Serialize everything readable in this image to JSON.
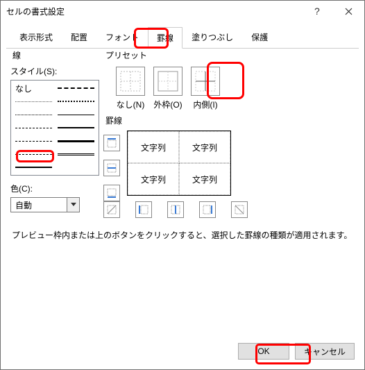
{
  "title": "セルの書式設定",
  "tabs": [
    "表示形式",
    "配置",
    "フォント",
    "罫線",
    "塗りつぶし",
    "保護"
  ],
  "active_tab": 3,
  "left": {
    "group": "線",
    "style_label": "スタイル(S):",
    "none_label": "なし",
    "color_label": "色(C):",
    "color_value": "自動"
  },
  "preset": {
    "group": "プリセット",
    "items": [
      {
        "label": "なし(N)"
      },
      {
        "label": "外枠(O)"
      },
      {
        "label": "内側(I)"
      }
    ]
  },
  "border": {
    "group": "罫線",
    "cells": [
      "文字列",
      "文字列",
      "文字列",
      "文字列"
    ]
  },
  "hint": "プレビュー枠内または上のボタンをクリックすると、選択した罫線の種類が適用されます。",
  "buttons": {
    "ok": "OK",
    "cancel": "キャンセル"
  }
}
